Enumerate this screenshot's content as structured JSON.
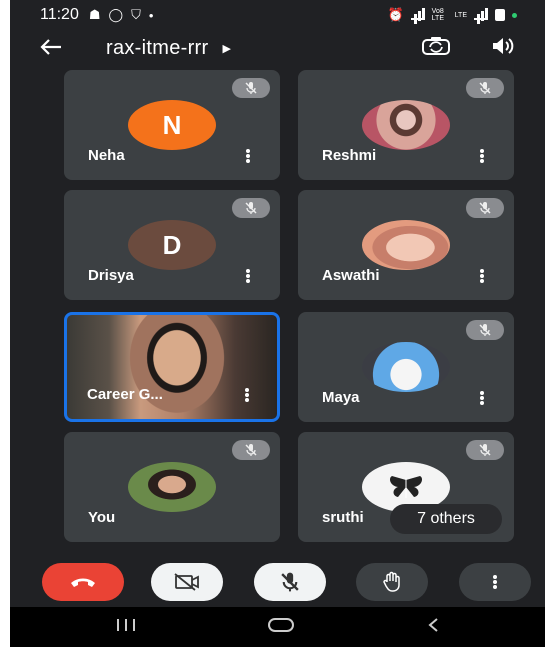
{
  "status_bar": {
    "time": "11:20",
    "network_labels": [
      "Vo8 LTE",
      "LTE"
    ]
  },
  "header": {
    "meeting_title": "rax-itme-rrr"
  },
  "participants": [
    {
      "name": "Neha",
      "initial": "N",
      "avatar_color": "#f4721b",
      "muted": true
    },
    {
      "name": "Reshmi",
      "muted": true
    },
    {
      "name": "Drisya",
      "initial": "D",
      "avatar_color": "#6b4b3e",
      "muted": true
    },
    {
      "name": "Aswathi",
      "muted": true
    },
    {
      "name": "Career G...",
      "muted": false,
      "active_speaker": true
    },
    {
      "name": "Maya",
      "muted": true
    },
    {
      "name": "You",
      "muted": true
    },
    {
      "name": "sruthi",
      "muted": true,
      "others_label": "7 others"
    }
  ],
  "colors": {
    "background": "#202124",
    "tile": "#3c4043",
    "end_call": "#ea4335",
    "active_border": "#1a73e8"
  },
  "controls": [
    "end-call",
    "camera-off",
    "mic-off",
    "raise-hand",
    "more-options"
  ]
}
